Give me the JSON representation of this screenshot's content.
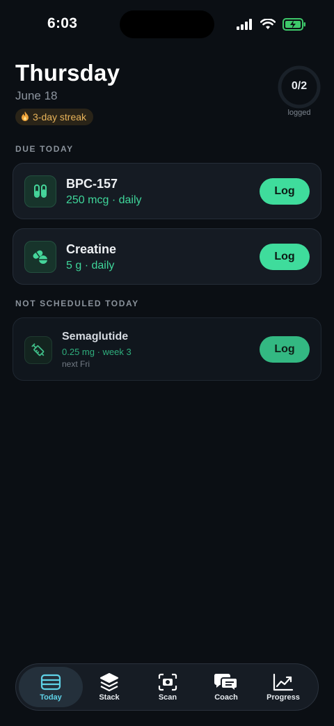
{
  "status_bar": {
    "time": "6:03"
  },
  "header": {
    "day": "Thursday",
    "date": "June 18",
    "streak": "3-day streak",
    "progress_count": "0/2",
    "progress_label": "logged",
    "progress_fraction": 0
  },
  "sections": {
    "due_today": "DUE TODAY",
    "not_scheduled": "NOT SCHEDULED TODAY"
  },
  "due_items": [
    {
      "name": "BPC-157",
      "dose": "250 mcg · daily",
      "icon": "vials-icon",
      "action": "Log"
    },
    {
      "name": "Creatine",
      "dose": "5 g · daily",
      "icon": "pills-icon",
      "action": "Log"
    }
  ],
  "unscheduled_items": [
    {
      "name": "Semaglutide",
      "dose": "0.25 mg · week 3",
      "next": "next Fri",
      "icon": "syringe-icon",
      "action": "Log"
    }
  ],
  "tabs": [
    {
      "label": "Today",
      "icon": "today-icon",
      "active": true
    },
    {
      "label": "Stack",
      "icon": "stack-icon",
      "active": false
    },
    {
      "label": "Scan",
      "icon": "camera-scan-icon",
      "active": false
    },
    {
      "label": "Coach",
      "icon": "chat-icon",
      "active": false
    },
    {
      "label": "Progress",
      "icon": "chart-icon",
      "active": false
    }
  ],
  "colors": {
    "background": "#0b0f14",
    "accent": "#3fdc9c",
    "streak": "#e9b45a",
    "active_tab": "#5fd3e8"
  }
}
